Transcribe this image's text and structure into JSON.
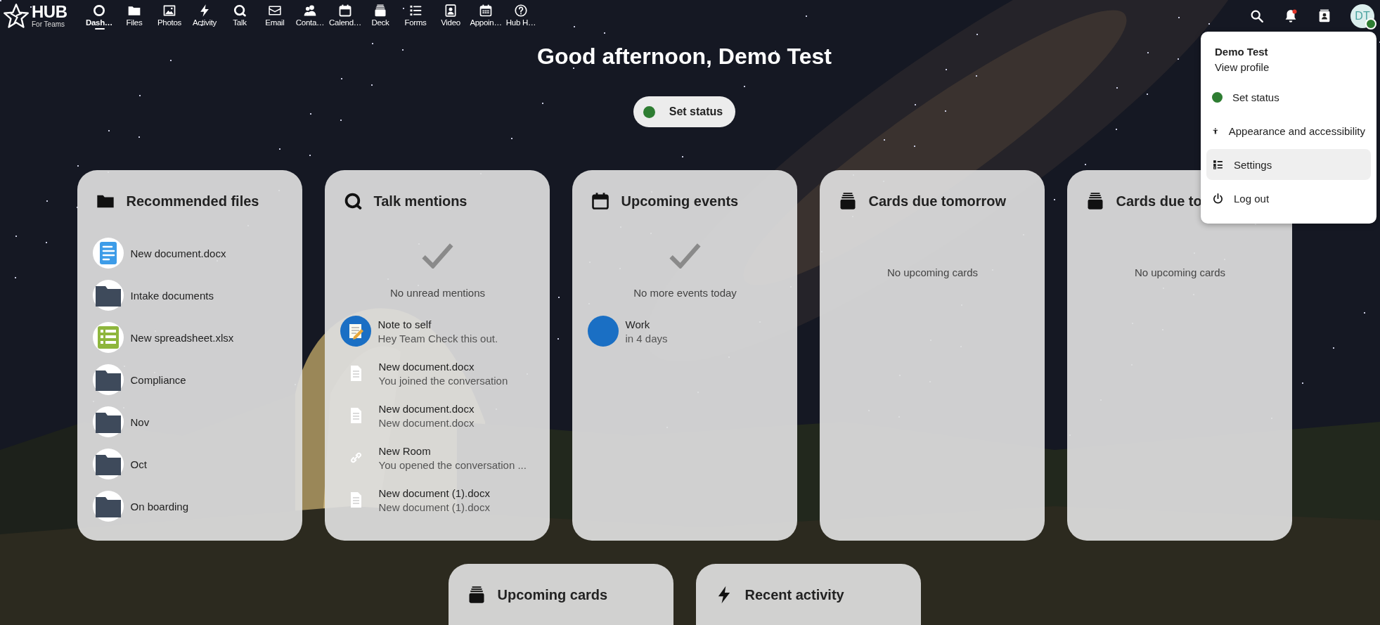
{
  "top_bar": {
    "logo": {
      "title": "HUB",
      "subtitle": "For Teams"
    },
    "apps": [
      {
        "label": "Dash…",
        "selected": true
      },
      {
        "label": "Files",
        "selected": false
      },
      {
        "label": "Photos",
        "selected": false
      },
      {
        "label": "Activity",
        "selected": false
      },
      {
        "label": "Talk",
        "selected": false
      },
      {
        "label": "Email",
        "selected": false
      },
      {
        "label": "Conta…",
        "selected": false
      },
      {
        "label": "Calend…",
        "selected": false
      },
      {
        "label": "Deck",
        "selected": false
      },
      {
        "label": "Forms",
        "selected": false
      },
      {
        "label": "Video",
        "selected": false
      },
      {
        "label": "Appoin…",
        "selected": false
      },
      {
        "label": "Hub H…",
        "selected": false
      }
    ],
    "notifications": {
      "unread": true
    },
    "avatar": {
      "initials": "DT",
      "online": true
    }
  },
  "greeting": "Good afternoon, Demo Test",
  "set_status": {
    "label": "Set status",
    "online": true
  },
  "widgets": [
    {
      "kind": "files",
      "title": "Recommended files",
      "items": [
        {
          "kind": "document",
          "name": "New document.docx"
        },
        {
          "kind": "folder",
          "name": "Intake documents"
        },
        {
          "kind": "spreadsheet",
          "name": "New spreadsheet.xlsx"
        },
        {
          "kind": "folder",
          "name": "Compliance"
        },
        {
          "kind": "folder",
          "name": "Nov"
        },
        {
          "kind": "folder",
          "name": "Oct"
        },
        {
          "kind": "folder",
          "name": "On boarding"
        }
      ]
    },
    {
      "kind": "talk",
      "title": "Talk mentions",
      "empty_check": true,
      "empty_message": "No unread mentions",
      "items": [
        {
          "kind": "note",
          "title": "Note to self",
          "subtitle": "Hey Team Check this out."
        },
        {
          "kind": "file",
          "title": "New document.docx",
          "subtitle": "You joined the conversation"
        },
        {
          "kind": "file",
          "title": "New document.docx",
          "subtitle": "New document.docx"
        },
        {
          "kind": "link",
          "title": "New Room",
          "subtitle": "You opened the conversation ..."
        },
        {
          "kind": "file",
          "title": "New document (1).docx",
          "subtitle": "New document (1).docx"
        }
      ]
    },
    {
      "kind": "calendar",
      "title": "Upcoming events",
      "empty_check": true,
      "empty_message": "No more events today",
      "items": [
        {
          "kind": "event",
          "title": "Work",
          "subtitle": "in 4 days",
          "color": "#1a6fc4"
        }
      ]
    },
    {
      "kind": "deck",
      "title": "Cards due tomorrow",
      "empty_check": false,
      "empty_message": "No upcoming cards"
    },
    {
      "kind": "deck",
      "title": "Cards due to",
      "empty_check": false,
      "empty_message": "No upcoming cards"
    },
    {
      "kind": "deck",
      "title": "Upcoming cards"
    },
    {
      "kind": "activity",
      "title": "Recent activity"
    }
  ],
  "account_menu": {
    "name": "Demo Test",
    "profile_link": "View profile",
    "items": [
      {
        "kind": "status",
        "label": "Set status",
        "selected": false
      },
      {
        "kind": "accessibility",
        "label": "Appearance and accessibility",
        "selected": false
      },
      {
        "kind": "settings",
        "label": "Settings",
        "selected": true
      },
      {
        "kind": "logout",
        "label": "Log out",
        "selected": false
      }
    ]
  }
}
